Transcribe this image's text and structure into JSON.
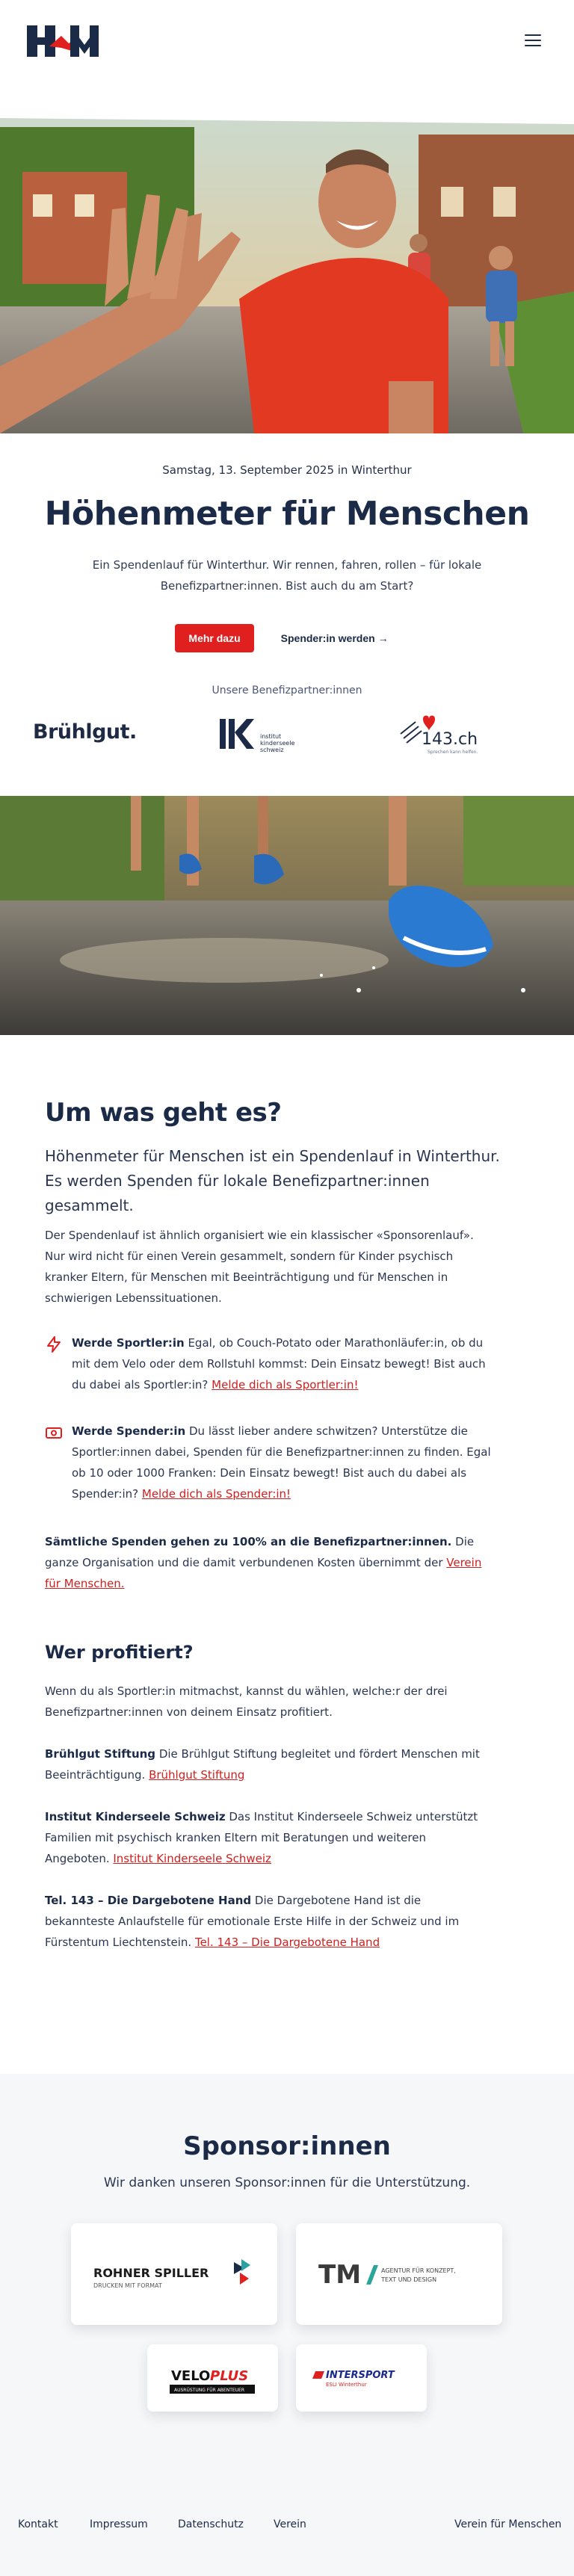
{
  "header": {
    "logo_text": "H&M",
    "menu_icon": "hamburger-icon"
  },
  "hero": {
    "event_date": "Samstag, 13. September 2025 in Winterthur",
    "title": "Höhenmeter für Menschen",
    "lead": "Ein Spendenlauf für Winterthur. Wir rennen, fahren, rollen – für lokale Benefizpartner:innen. Bist auch du am Start?",
    "cta_primary": "Mehr dazu",
    "cta_secondary": "Spender:in werden →",
    "beneficiaries_label": "Unsere Benefizpartner:innen",
    "beneficiary_logos": {
      "bruehlgut": "Brühlgut.",
      "iks_line1": "institut",
      "iks_line2": "kinderseele",
      "iks_line3": "schweiz",
      "tel143": "143.ch",
      "tel143_sub": "Sprechen kann helfen."
    }
  },
  "about": {
    "title": "Um was geht es?",
    "lead": "Höhenmeter für Menschen ist ein Spendenlauf in Winterthur. Es werden Spenden für lokale Benefizpartner:innen gesammelt.",
    "body": "Der Spendenlauf ist ähnlich organisiert wie ein klassischer «Sponsorenlauf». Nur wird nicht für einen Verein gesammelt, sondern für Kinder psychisch kranker Eltern, für Menschen mit Beeinträchtigung und für Menschen in schwierigen Lebenssituationen.",
    "feature1": {
      "icon": "lightning-icon",
      "strong": "Werde Sportler:in",
      "text": " Egal, ob Couch-Potato oder Marathonläufer:in, ob du mit dem Velo oder dem Rollstuhl kommst: Dein Einsatz bewegt! Bist auch du dabei als Sportler:in? ",
      "link": "Melde dich als Sportler:in!"
    },
    "feature2": {
      "icon": "banknote-icon",
      "strong": "Werde Spender:in",
      "text": " Du lässt lieber andere schwitzen? Unterstütze die Sportler:innen dabei, Spenden für die Benefizpartner:innen zu finden. Egal ob 10 oder 1000 Franken: Dein Einsatz bewegt! Bist auch du dabei als Spender:in? ",
      "link": "Melde dich als Spender:in!"
    },
    "donation_note": {
      "strong": "Sämtliche Spenden gehen zu 100% an die Benefizpartner:innen.",
      "text": " Die ganze Organisation und die damit verbundenen Kosten übernimmt der ",
      "link": "Verein für Menschen."
    }
  },
  "profit": {
    "title": "Wer profitiert?",
    "intro": "Wenn du als Sportler:in mitmachst, kannst du wählen, welche:r der drei Benefizpartner:innen von deinem Einsatz profitiert.",
    "partners": [
      {
        "name": "Brühlgut Stiftung",
        "text": " Die Brühlgut Stiftung begleitet und fördert Menschen mit Beeinträchtigung. ",
        "link": "Brühlgut Stiftung"
      },
      {
        "name": "Institut Kinderseele Schweiz",
        "text": " Das Institut Kinderseele Schweiz unterstützt Familien mit psychisch kranken Eltern mit Beratungen und weiteren Angeboten. ",
        "link": "Institut Kinderseele Schweiz"
      },
      {
        "name": "Tel. 143 – Die Dargebotene Hand",
        "text": " Die Dargebotene Hand ist die bekannteste Anlaufstelle für emotionale Erste Hilfe in der Schweiz und im Fürstentum Liechtenstein. ",
        "link": "Tel. 143 – Die Dargebotene Hand"
      }
    ]
  },
  "sponsors": {
    "title": "Sponsor:innen",
    "subtitle": "Wir danken unseren Sponsor:innen für die Unterstützung.",
    "logos": {
      "rohner_name": "ROHNER SPILLER",
      "rohner_tag": "DRUCKEN MIT FORMAT",
      "tm_mark": "TM",
      "tm_line1": "AGENTUR FÜR KONZEPT,",
      "tm_line2": "TEXT UND DESIGN",
      "veloplus_a": "VELO",
      "veloplus_b": "PLUS",
      "veloplus_tag": "AUSRÜSTUNG FÜR ABENTEUER",
      "intersport": "INTERSPORT",
      "intersport_sub": "ESLI Winterthur"
    }
  },
  "footer": {
    "links": [
      "Kontakt",
      "Impressum",
      "Datenschutz",
      "Verein"
    ],
    "right": "Verein für Menschen"
  },
  "colors": {
    "brand_red": "#e0201f",
    "navy": "#1b2a47"
  }
}
